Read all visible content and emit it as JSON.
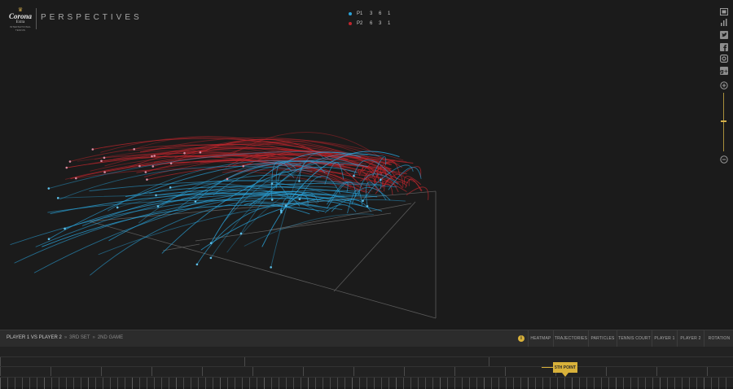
{
  "header": {
    "logo": {
      "crown": "♛",
      "brand": "Corona",
      "sub": "Extra",
      "tag": "INTERNATIONAL TENNIS"
    },
    "title": "PERSPECTIVES"
  },
  "score": {
    "players": [
      {
        "name": "P1",
        "points": "3 6 1",
        "color": "#2aa2d8"
      },
      {
        "name": "P2",
        "points": "6 3 1",
        "color": "#c0262d"
      }
    ]
  },
  "rail": {
    "icons": [
      "fullscreen-icon",
      "bar-chart-icon",
      "twitter-icon",
      "facebook-icon",
      "instagram-icon",
      "google-plus-icon"
    ],
    "zoom_in": "+",
    "zoom_out": "−",
    "zoom_level": 0.48
  },
  "breadcrumb": {
    "match": "PLAYER 1 VS PLAYER 2",
    "set": "3RD SET",
    "game": "2ND GAME",
    "separator": "»"
  },
  "info": "i",
  "nav": [
    {
      "key": "heatmap",
      "label": "HEATMAP"
    },
    {
      "key": "trajectories",
      "label": "TRAJECTORIES"
    },
    {
      "key": "particles",
      "label": "PARTICLES"
    },
    {
      "key": "tennis-court",
      "label": "TENNIS COURT"
    },
    {
      "key": "player-1",
      "label": "PLAYER 1"
    },
    {
      "key": "player-2",
      "label": "PLAYER 2"
    },
    {
      "key": "rotation",
      "label": "ROTATION"
    }
  ],
  "timeline": {
    "current_point": "5TH POINT"
  },
  "colors": {
    "p1": "#2aa2d8",
    "p2": "#c0262d",
    "accent": "#d8b13a",
    "court": "#5e5e5e",
    "background": "#1b1b1b"
  }
}
